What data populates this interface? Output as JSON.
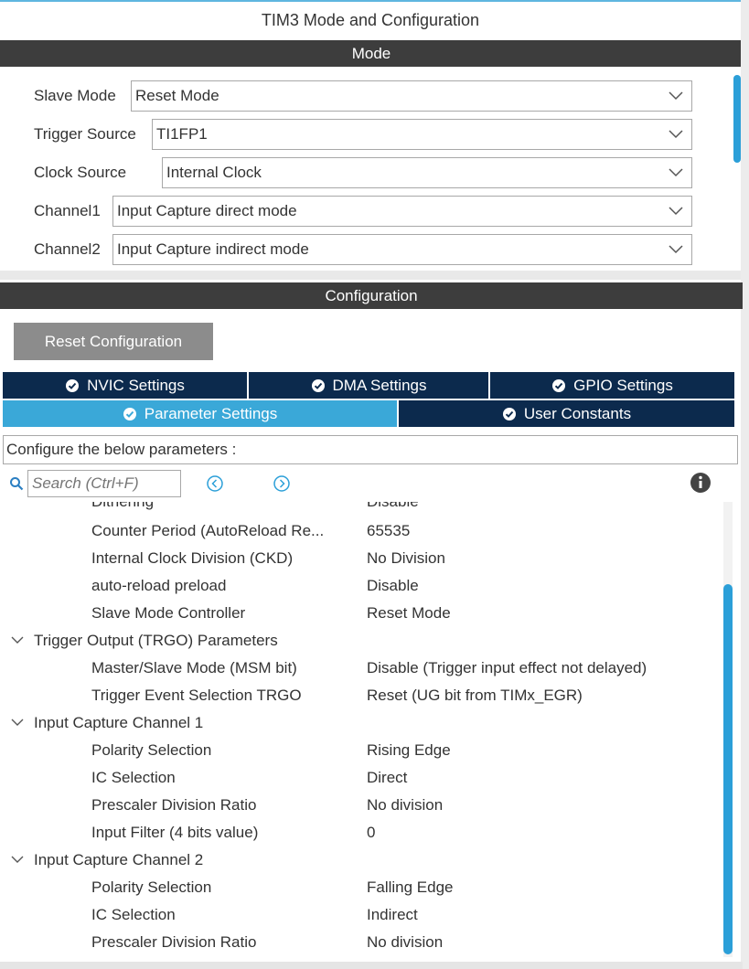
{
  "window": {
    "title": "TIM3 Mode and Configuration"
  },
  "mode": {
    "section_label": "Mode",
    "fields": [
      {
        "label": "Slave Mode",
        "value": "Reset Mode"
      },
      {
        "label": "Trigger Source",
        "value": "TI1FP1"
      },
      {
        "label": "Clock Source",
        "value": "Internal Clock"
      },
      {
        "label": "Channel1",
        "value": "Input Capture direct mode"
      },
      {
        "label": "Channel2",
        "value": "Input Capture indirect mode"
      }
    ]
  },
  "configuration": {
    "section_label": "Configuration",
    "reset_button": "Reset Configuration",
    "tabs_row1": [
      {
        "label": "NVIC Settings"
      },
      {
        "label": "DMA Settings"
      },
      {
        "label": "GPIO Settings"
      }
    ],
    "tabs_row2": [
      {
        "label": "Parameter Settings",
        "active": true
      },
      {
        "label": "User Constants"
      }
    ],
    "configure_text": "Configure the below parameters :",
    "search": {
      "placeholder": "Search (Ctrl+F)"
    },
    "params": {
      "partial": {
        "name": "Dithering",
        "value": "Disable"
      },
      "rows_top": [
        {
          "name": "Counter Period (AutoReload Re...",
          "value": "65535"
        },
        {
          "name": "Internal Clock Division (CKD)",
          "value": "No Division"
        },
        {
          "name": "auto-reload preload",
          "value": "Disable"
        },
        {
          "name": "Slave Mode Controller",
          "value": "Reset Mode"
        }
      ],
      "group_trgo": {
        "label": "Trigger Output (TRGO) Parameters",
        "rows": [
          {
            "name": "Master/Slave Mode (MSM bit)",
            "value": "Disable (Trigger input effect not delayed)"
          },
          {
            "name": "Trigger Event Selection TRGO",
            "value": "Reset (UG bit from TIMx_EGR)"
          }
        ]
      },
      "group_ic1": {
        "label": "Input Capture Channel 1",
        "rows": [
          {
            "name": "Polarity Selection",
            "value": "Rising Edge"
          },
          {
            "name": "IC Selection",
            "value": "Direct"
          },
          {
            "name": "Prescaler Division Ratio",
            "value": "No division"
          },
          {
            "name": "Input Filter (4 bits value)",
            "value": "0"
          }
        ]
      },
      "group_ic2": {
        "label": "Input Capture Channel 2",
        "rows": [
          {
            "name": "Polarity Selection",
            "value": "Falling Edge"
          },
          {
            "name": "IC Selection",
            "value": "Indirect"
          },
          {
            "name": "Prescaler Division Ratio",
            "value": "No division"
          }
        ]
      }
    }
  },
  "colors": {
    "section_bar": "#3d3d3d",
    "tab_dark": "#0c2a4d",
    "tab_active": "#3aa8d8",
    "scroll_thumb": "#2b9fd8",
    "reset_button": "#8c8c8c"
  }
}
